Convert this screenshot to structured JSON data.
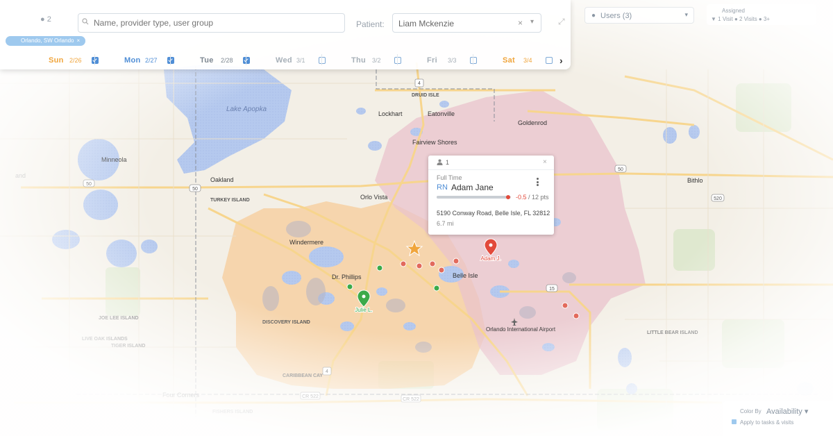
{
  "panel": {
    "count_text": "●  2",
    "search_placeholder": "Name, provider type, user group",
    "patient_label": "Patient:",
    "patient_value": "Liam Mckenzie",
    "patient_clear": "×",
    "patient_chevron": "▾",
    "expand_icon": "⤢",
    "chip_label": "Orlando, SW Orlando",
    "chip_close": "×",
    "days": [
      {
        "name": "Sun",
        "date": "2/26",
        "checked": true,
        "color": "#f0a53c"
      },
      {
        "name": "Mon",
        "date": "2/27",
        "checked": true,
        "color": "#4f8ed6"
      },
      {
        "name": "Tue",
        "date": "2/28",
        "checked": true,
        "color": "#7d8791"
      },
      {
        "name": "Wed",
        "date": "3/1",
        "checked": false,
        "color": "#a7b0b8"
      },
      {
        "name": "Thu",
        "date": "3/2",
        "checked": false,
        "color": "#a7b0b8"
      },
      {
        "name": "Fri",
        "date": "3/3",
        "checked": false,
        "color": "#a7b0b8"
      },
      {
        "name": "Sat",
        "date": "3/4",
        "checked": false,
        "color": "#f0a53c"
      }
    ],
    "next_arrow": "›"
  },
  "top_right": {
    "users_label": "Users (3)",
    "users_chevron": "▾",
    "legend_line1": "Assigned",
    "legend_line2": "▼ 1 Visit  ● 2 Visits  ● 3+"
  },
  "popup": {
    "count": "1",
    "close": "×",
    "employment": "Full Time",
    "role": "RN",
    "name": "Adam Jane",
    "points_delta": "-0.5",
    "points_total": "/ 12 pts",
    "points_fraction": 0.96,
    "address": "5190 Conway Road, Belle Isle, FL 32812",
    "distance": "6.7 mi"
  },
  "color_by": {
    "label": "Color By",
    "value": "Availability",
    "chevron": "▾",
    "option": "Apply to tasks & visits"
  },
  "map_labels": {
    "druid_isle": "DRUID ISLE",
    "lockhart": "Lockhart",
    "eatonville": "Eatonville",
    "goldenrod": "Goldenrod",
    "fairview_shores": "Fairview Shores",
    "lake_apopka": "Lake Apopka",
    "minneola": "Minneola",
    "oakland": "Oakland",
    "turkey_island": "TURKEY ISLAND",
    "orlo_vista": "Orlo Vista",
    "windermere": "Windermere",
    "dr_phillips": "Dr. Phillips",
    "belle_isle": "Belle Isle",
    "bithlo": "Bithlo",
    "joe_lee_island": "JOE LEE ISLAND",
    "live_oak_islands": "LIVE OAK ISLANDS",
    "tiger_island": "TIGER ISLAND",
    "discovery_island": "DISCOVERY ISLAND",
    "orlando_airport": "Orlando International Airport",
    "little_bear_island": "LITTLE BEAR ISLAND",
    "caribbean_cay": "CARIBBEAN CAY",
    "four_corners": "Four Corners",
    "fishers_island": "FISHERS ISLAND",
    "cr522_a": "CR 522",
    "cr522_b": "CR 522",
    "route_4_top": "4",
    "route_4_bottom": "4",
    "route_50_a": "50",
    "route_50_b": "50",
    "route_50_c": "50",
    "route_15": "15",
    "route_520": "520",
    "lnd": "and"
  },
  "markers": {
    "julie_label": "Julie L.",
    "adam_label": "Adam J."
  }
}
